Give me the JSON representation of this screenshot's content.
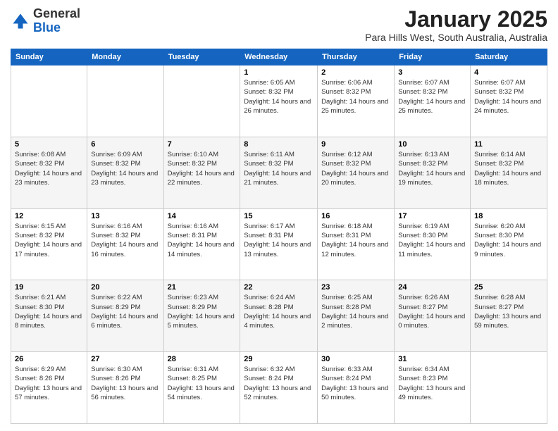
{
  "header": {
    "logo_general": "General",
    "logo_blue": "Blue",
    "month": "January 2025",
    "location": "Para Hills West, South Australia, Australia"
  },
  "days_of_week": [
    "Sunday",
    "Monday",
    "Tuesday",
    "Wednesday",
    "Thursday",
    "Friday",
    "Saturday"
  ],
  "weeks": [
    [
      {
        "day": "",
        "info": ""
      },
      {
        "day": "",
        "info": ""
      },
      {
        "day": "",
        "info": ""
      },
      {
        "day": "1",
        "info": "Sunrise: 6:05 AM\nSunset: 8:32 PM\nDaylight: 14 hours and 26 minutes."
      },
      {
        "day": "2",
        "info": "Sunrise: 6:06 AM\nSunset: 8:32 PM\nDaylight: 14 hours and 25 minutes."
      },
      {
        "day": "3",
        "info": "Sunrise: 6:07 AM\nSunset: 8:32 PM\nDaylight: 14 hours and 25 minutes."
      },
      {
        "day": "4",
        "info": "Sunrise: 6:07 AM\nSunset: 8:32 PM\nDaylight: 14 hours and 24 minutes."
      }
    ],
    [
      {
        "day": "5",
        "info": "Sunrise: 6:08 AM\nSunset: 8:32 PM\nDaylight: 14 hours and 23 minutes."
      },
      {
        "day": "6",
        "info": "Sunrise: 6:09 AM\nSunset: 8:32 PM\nDaylight: 14 hours and 23 minutes."
      },
      {
        "day": "7",
        "info": "Sunrise: 6:10 AM\nSunset: 8:32 PM\nDaylight: 14 hours and 22 minutes."
      },
      {
        "day": "8",
        "info": "Sunrise: 6:11 AM\nSunset: 8:32 PM\nDaylight: 14 hours and 21 minutes."
      },
      {
        "day": "9",
        "info": "Sunrise: 6:12 AM\nSunset: 8:32 PM\nDaylight: 14 hours and 20 minutes."
      },
      {
        "day": "10",
        "info": "Sunrise: 6:13 AM\nSunset: 8:32 PM\nDaylight: 14 hours and 19 minutes."
      },
      {
        "day": "11",
        "info": "Sunrise: 6:14 AM\nSunset: 8:32 PM\nDaylight: 14 hours and 18 minutes."
      }
    ],
    [
      {
        "day": "12",
        "info": "Sunrise: 6:15 AM\nSunset: 8:32 PM\nDaylight: 14 hours and 17 minutes."
      },
      {
        "day": "13",
        "info": "Sunrise: 6:16 AM\nSunset: 8:32 PM\nDaylight: 14 hours and 16 minutes."
      },
      {
        "day": "14",
        "info": "Sunrise: 6:16 AM\nSunset: 8:31 PM\nDaylight: 14 hours and 14 minutes."
      },
      {
        "day": "15",
        "info": "Sunrise: 6:17 AM\nSunset: 8:31 PM\nDaylight: 14 hours and 13 minutes."
      },
      {
        "day": "16",
        "info": "Sunrise: 6:18 AM\nSunset: 8:31 PM\nDaylight: 14 hours and 12 minutes."
      },
      {
        "day": "17",
        "info": "Sunrise: 6:19 AM\nSunset: 8:30 PM\nDaylight: 14 hours and 11 minutes."
      },
      {
        "day": "18",
        "info": "Sunrise: 6:20 AM\nSunset: 8:30 PM\nDaylight: 14 hours and 9 minutes."
      }
    ],
    [
      {
        "day": "19",
        "info": "Sunrise: 6:21 AM\nSunset: 8:30 PM\nDaylight: 14 hours and 8 minutes."
      },
      {
        "day": "20",
        "info": "Sunrise: 6:22 AM\nSunset: 8:29 PM\nDaylight: 14 hours and 6 minutes."
      },
      {
        "day": "21",
        "info": "Sunrise: 6:23 AM\nSunset: 8:29 PM\nDaylight: 14 hours and 5 minutes."
      },
      {
        "day": "22",
        "info": "Sunrise: 6:24 AM\nSunset: 8:28 PM\nDaylight: 14 hours and 4 minutes."
      },
      {
        "day": "23",
        "info": "Sunrise: 6:25 AM\nSunset: 8:28 PM\nDaylight: 14 hours and 2 minutes."
      },
      {
        "day": "24",
        "info": "Sunrise: 6:26 AM\nSunset: 8:27 PM\nDaylight: 14 hours and 0 minutes."
      },
      {
        "day": "25",
        "info": "Sunrise: 6:28 AM\nSunset: 8:27 PM\nDaylight: 13 hours and 59 minutes."
      }
    ],
    [
      {
        "day": "26",
        "info": "Sunrise: 6:29 AM\nSunset: 8:26 PM\nDaylight: 13 hours and 57 minutes."
      },
      {
        "day": "27",
        "info": "Sunrise: 6:30 AM\nSunset: 8:26 PM\nDaylight: 13 hours and 56 minutes."
      },
      {
        "day": "28",
        "info": "Sunrise: 6:31 AM\nSunset: 8:25 PM\nDaylight: 13 hours and 54 minutes."
      },
      {
        "day": "29",
        "info": "Sunrise: 6:32 AM\nSunset: 8:24 PM\nDaylight: 13 hours and 52 minutes."
      },
      {
        "day": "30",
        "info": "Sunrise: 6:33 AM\nSunset: 8:24 PM\nDaylight: 13 hours and 50 minutes."
      },
      {
        "day": "31",
        "info": "Sunrise: 6:34 AM\nSunset: 8:23 PM\nDaylight: 13 hours and 49 minutes."
      },
      {
        "day": "",
        "info": ""
      }
    ]
  ]
}
